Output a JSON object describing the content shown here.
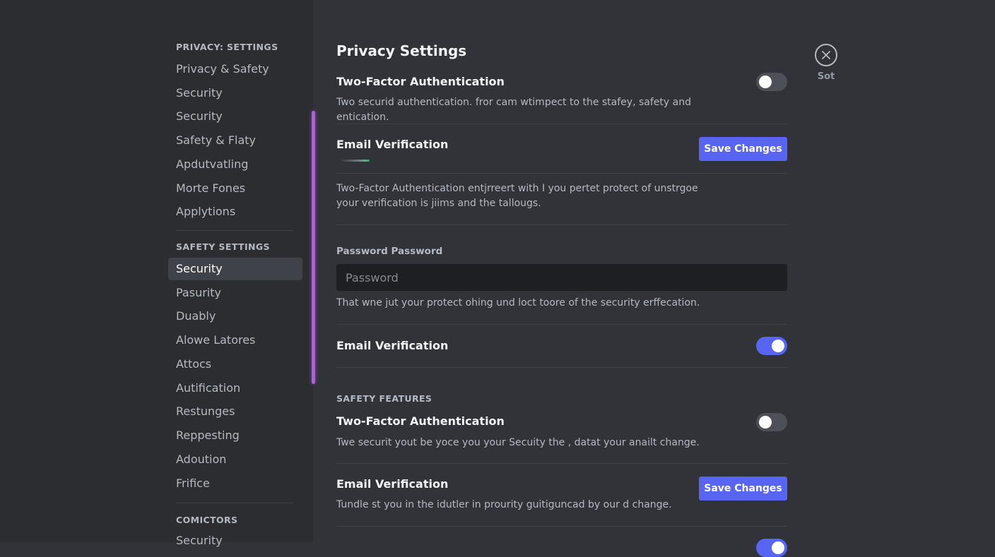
{
  "sidebar": {
    "groups": [
      {
        "header": "PRIVACY: SETTINGS",
        "items": [
          "Privacy & Safety",
          "Security",
          "Security",
          "Safety & Flaty",
          "Apdutvatling",
          "Morte Fones",
          "Applytions"
        ]
      },
      {
        "header": "SAFETY SETTINGS",
        "items": [
          "Security",
          "Pasurity",
          "Duably",
          "Alowe Latores",
          "Attocs",
          "Autification",
          "Restunges",
          "Reppesting",
          "Adoution",
          "Frifice"
        ]
      },
      {
        "header": "COMICTORS",
        "items": [
          "Security"
        ]
      }
    ],
    "selected_item": "SAFETY SETTINGS > Security"
  },
  "close": {
    "label": "Sot",
    "icon": "close-icon"
  },
  "main": {
    "title": "Privacy Settings",
    "rows": [
      {
        "title": "Two-Factor Authentication",
        "description": "Two securid authentication. fror cam wtimpect to the stafey, safety and entication.",
        "toggle_on": false
      },
      {
        "title": "Email Verification",
        "button": "Save Changes",
        "strength_indicator": "green"
      },
      {
        "description": "Two-Factor Authentication entjrreert with I you pertet protect of unstrgoe your verification is jiims and the tallougs."
      },
      {
        "field_label": "Password Password",
        "input_placeholder": "Password",
        "input_value": "",
        "help_text": "That wne jut your protect ohing und loct toore of the security erffecation."
      },
      {
        "title": "Email Verification",
        "toggle_on": true
      }
    ],
    "safety_section": {
      "label": "SAFETY FEATURES",
      "rows": [
        {
          "title": "Two-Factor Authentication",
          "description": "Twe securit yout be yoce you your Secuity the , datat your anailt change.",
          "toggle_on": false
        },
        {
          "title": "Email Verification",
          "description": "Tundle st you in the idutler in prourity guitiguncad by our d change.",
          "button": "Save Changes"
        }
      ]
    }
  },
  "colors": {
    "background": "#313338",
    "sidebar_bg": "#2b2d31",
    "accent": "#5865f2",
    "accent_bar": "#b15ce3",
    "text_primary": "#f2f3f5",
    "text_muted": "#b5bac1",
    "input_bg": "#1e1f22"
  }
}
